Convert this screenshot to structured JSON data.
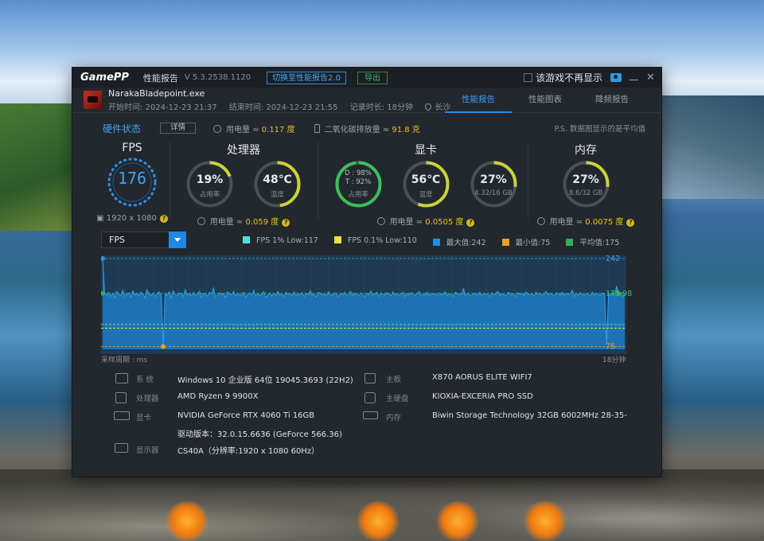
{
  "titlebar": {
    "logo": "GamePP",
    "title": "性能报告",
    "version": "V 5.3.2538.1120",
    "switch_button": "切换至性能报告2.0",
    "export_button": "导出",
    "no_show_label": "该游戏不再显示"
  },
  "header": {
    "exe_name": "NarakaBladepoint.exe",
    "start_time": "开始时间: 2024-12-23 21:37",
    "end_time": "结束时间: 2024-12-23 21:55",
    "duration": "记录时长: 18分钟",
    "location": "长沙",
    "tabs": [
      {
        "label": "性能报告",
        "active": true
      },
      {
        "label": "性能图表",
        "active": false
      },
      {
        "label": "降频报告",
        "active": false
      }
    ]
  },
  "hw_status": {
    "title": "硬件状态",
    "detail_button": "详情",
    "power_label": "用电量 ≈",
    "power_value": "0.117 度",
    "co2_label": "二氧化碳排放量 ≈",
    "co2_value": "91.8 克",
    "note": "P.S. 数据图显示的是平均值"
  },
  "fps_group": {
    "title": "FPS",
    "value": "176",
    "resolution": "1920 x 1080"
  },
  "cpu_group": {
    "title": "处理器",
    "usage_value": "19%",
    "usage_label": "占用率",
    "usage_fraction": 0.19,
    "temp_value": "48℃",
    "temp_label": "温度",
    "temp_fraction": 0.48,
    "power_label": "用电量 ≈",
    "power_value": "0.059 度"
  },
  "gpu_group": {
    "title": "显卡",
    "d3d_value": "D : 98%",
    "t_value": "T : 92%",
    "usage_label": "占用率",
    "usage_fraction": 0.98,
    "temp_value": "56℃",
    "temp_label": "温度",
    "temp_fraction": 0.56,
    "vram_value": "27%",
    "vram_label": "4.32/16 GB",
    "vram_fraction": 0.27,
    "power_label": "用电量 ≈",
    "power_value": "0.0505 度"
  },
  "mem_group": {
    "title": "内存",
    "value": "27%",
    "label": "8.6/32 GB",
    "fraction": 0.27,
    "power_label": "用电量 ≈",
    "power_value": "0.0075 度"
  },
  "chart_controls": {
    "metric_select": "FPS",
    "legend": [
      {
        "label": "FPS 1% Low:117",
        "color": "#4fe0d8"
      },
      {
        "label": "FPS 0.1% Low:110",
        "color": "#f0e040"
      },
      {
        "label": "最大值:242",
        "color": "#1e8fe8"
      },
      {
        "label": "最小值:75",
        "color": "#e8a020"
      },
      {
        "label": "平均值:175",
        "color": "#2fae58"
      }
    ]
  },
  "chart_data": {
    "type": "area",
    "xlabel": "采样周期 : ms",
    "x_end_label": "18分钟",
    "ylim": [
      70,
      245
    ],
    "markers": {
      "max": "242",
      "avg": "175.98",
      "min": "75"
    },
    "reference_lines": {
      "max": 242,
      "avg": 175.98,
      "min": 75,
      "low1": 117,
      "low01": 110
    },
    "values": [
      242,
      175,
      172,
      178,
      170,
      176,
      168,
      180,
      174,
      172,
      182,
      170,
      175,
      177,
      169,
      181,
      173,
      176,
      171,
      178,
      175,
      168,
      183,
      174,
      172,
      177,
      170,
      176,
      179,
      173,
      75,
      176,
      172,
      179,
      168,
      181,
      174,
      172,
      177,
      175,
      170,
      183,
      173,
      176,
      171,
      178,
      172,
      175,
      180,
      169,
      176,
      174,
      171,
      178,
      175,
      186,
      170,
      173,
      177,
      172,
      176,
      168,
      179,
      175,
      173,
      180,
      171,
      176,
      174,
      172,
      178,
      169,
      175,
      177,
      173,
      182,
      170,
      176,
      172,
      175,
      179,
      168,
      174,
      177,
      171,
      176,
      173,
      180,
      172,
      175,
      170,
      178,
      174,
      176,
      172,
      179,
      171,
      175,
      173,
      177,
      170,
      176,
      174,
      181,
      172,
      175,
      169,
      178,
      176,
      173,
      175,
      171,
      179,
      174,
      172,
      177,
      175,
      170,
      176,
      173,
      178,
      172,
      175,
      180,
      171,
      176,
      174,
      172,
      177,
      175,
      169,
      176,
      173,
      181,
      172,
      175,
      178,
      170,
      176,
      174,
      173,
      177,
      175,
      171,
      179,
      173,
      176,
      172,
      175,
      178,
      170,
      176,
      173,
      177,
      174,
      172,
      176,
      180,
      171,
      175,
      173,
      178,
      172,
      176,
      174,
      175,
      171,
      177,
      173,
      176,
      179,
      172,
      175,
      174,
      170,
      178,
      176,
      173,
      175,
      185,
      172,
      176,
      174,
      171,
      177,
      175,
      173,
      178,
      172,
      176,
      174,
      175,
      170,
      177,
      173,
      176,
      180,
      172,
      175,
      174,
      171,
      178,
      176,
      173,
      175,
      170,
      177,
      174,
      176,
      172,
      179,
      175,
      173,
      176,
      171,
      178,
      174,
      176,
      172,
      175,
      180,
      173,
      176,
      174,
      171,
      177,
      175,
      173,
      178,
      172,
      176,
      174,
      175,
      182,
      170,
      176,
      173,
      177,
      174,
      172,
      176,
      175,
      171,
      178,
      173,
      176,
      174,
      172,
      177,
      175,
      80,
      176,
      173,
      178,
      172,
      190,
      174,
      175,
      170,
      176
    ]
  },
  "sysinfo": {
    "os_label": "系  统",
    "os_value": "Windows 10 企业版 64位 19045.3693 (22H2)",
    "cpu_label": "处理器",
    "cpu_value": "AMD Ryzen 9 9900X",
    "gpu_label": "显卡",
    "gpu_value": "NVIDIA GeForce RTX 4060 Ti 16GB",
    "driver_value": "驱动版本：32.0.15.6636 (GeForce 566.36)",
    "display_label": "显示器",
    "display_value": "CS40A（分辨率:1920 x 1080 60Hz）",
    "mb_label": "主板",
    "mb_value": "X870 AORUS ELITE WIFI7",
    "disk_label": "主硬盘",
    "disk_value": "KIOXIA-EXCERIA PRO SSD",
    "mem_label": "内存",
    "mem_value": "Biwin Storage Technology 32GB 6002MHz 28-35-"
  }
}
